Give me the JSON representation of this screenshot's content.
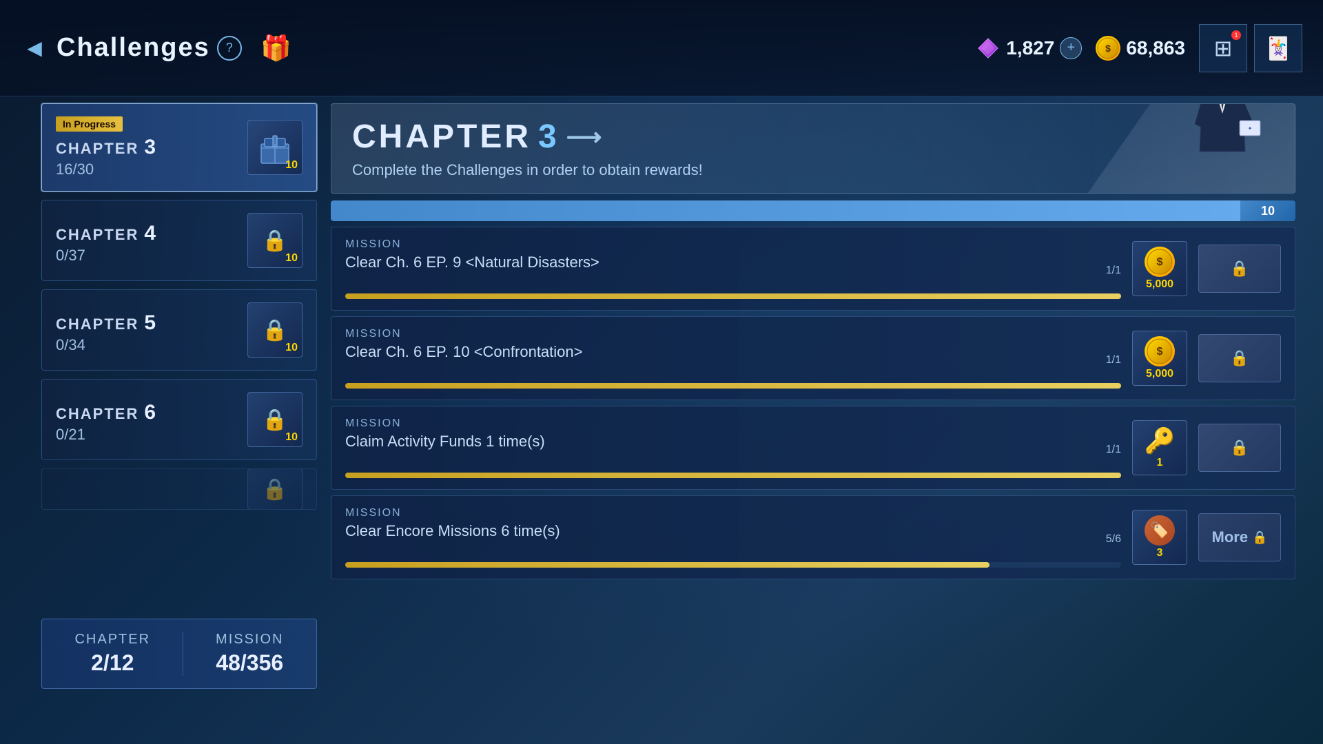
{
  "header": {
    "back_label": "◀",
    "title": "Challenges",
    "question_label": "?",
    "gift_icon": "🎁",
    "currency": {
      "gem_value": "1,827",
      "plus_label": "+",
      "coin_value": "68,863"
    },
    "icons": [
      {
        "id": "grid-icon",
        "label": "⊞",
        "notification": "1"
      },
      {
        "id": "card-icon",
        "label": "🂠",
        "notification": ""
      }
    ]
  },
  "sidebar": {
    "chapters": [
      {
        "id": "chapter-3",
        "label": "CHAPTER",
        "number": "3",
        "progress": "16/30",
        "in_progress": true,
        "in_progress_label": "In Progress",
        "locked": false,
        "reward_count": "10"
      },
      {
        "id": "chapter-4",
        "label": "CHAPTER",
        "number": "4",
        "progress": "0/37",
        "in_progress": false,
        "locked": true,
        "reward_count": "10"
      },
      {
        "id": "chapter-5",
        "label": "CHAPTER",
        "number": "5",
        "progress": "0/34",
        "in_progress": false,
        "locked": true,
        "reward_count": "10"
      },
      {
        "id": "chapter-6",
        "label": "CHAPTER",
        "number": "6",
        "progress": "0/21",
        "in_progress": false,
        "locked": true,
        "reward_count": "10"
      }
    ],
    "summary": {
      "chapter_label": "CHAPTER",
      "chapter_value": "2/12",
      "mission_label": "MISSION",
      "mission_value": "48/356"
    }
  },
  "main": {
    "chapter_title": "CHAPTER",
    "chapter_number": "3",
    "chapter_subtitle": "Complete the Challenges in order to obtain rewards!",
    "missions": [
      {
        "id": "mission-1",
        "label": "MISSION",
        "text": "Clear Ch. 6 EP. 9 <Natural Disasters>",
        "progress": "1/1",
        "progress_pct": 100,
        "reward_type": "coin",
        "reward_amount": "5,000",
        "button_type": "locked"
      },
      {
        "id": "mission-2",
        "label": "MISSION",
        "text": "Clear Ch. 6 EP. 10 <Confrontation>",
        "progress": "1/1",
        "progress_pct": 100,
        "reward_type": "coin",
        "reward_amount": "5,000",
        "button_type": "locked"
      },
      {
        "id": "mission-3",
        "label": "MISSION",
        "text": "Claim Activity Funds 1 time(s)",
        "progress": "1/1",
        "progress_pct": 100,
        "reward_type": "key",
        "reward_amount": "1",
        "button_type": "locked"
      },
      {
        "id": "mission-4",
        "label": "MISSION",
        "text": "Clear Encore Missions 6 time(s)",
        "progress": "5/6",
        "progress_pct": 83,
        "reward_type": "stamp",
        "reward_amount": "3",
        "button_type": "more"
      }
    ],
    "top_bar_button": "10"
  }
}
